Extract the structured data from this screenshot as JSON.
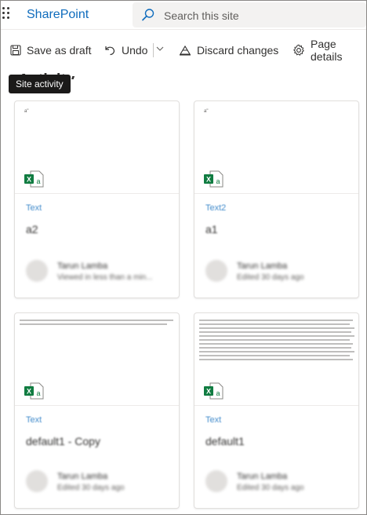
{
  "suite": {
    "brand": "SharePoint",
    "search_placeholder": "Search this site"
  },
  "command_bar": {
    "save_label": "Save as draft",
    "undo_label": "Undo",
    "discard_label": "Discard changes",
    "details_label": "Page details"
  },
  "section": {
    "heading": "Activity"
  },
  "tooltip": "Site activity",
  "cards": [
    {
      "preview_text": "a\"",
      "file_type": "Text",
      "title": "a2",
      "user_name": "Tarun Lamba",
      "activity": "Viewed in less than a min..."
    },
    {
      "preview_text": "a\"",
      "file_type": "Text2",
      "title": "a1",
      "user_name": "Tarun Lamba",
      "activity": "Edited 30 days ago"
    },
    {
      "file_type": "Text",
      "title": "default1 - Copy",
      "user_name": "Tarun Lamba",
      "activity": "Edited 30 days ago"
    },
    {
      "file_type": "Text",
      "title": "default1",
      "user_name": "Tarun Lamba",
      "activity": "Edited 30 days ago"
    }
  ],
  "colors": {
    "brand": "#0f6cbd",
    "excel_green": "#107c41"
  }
}
